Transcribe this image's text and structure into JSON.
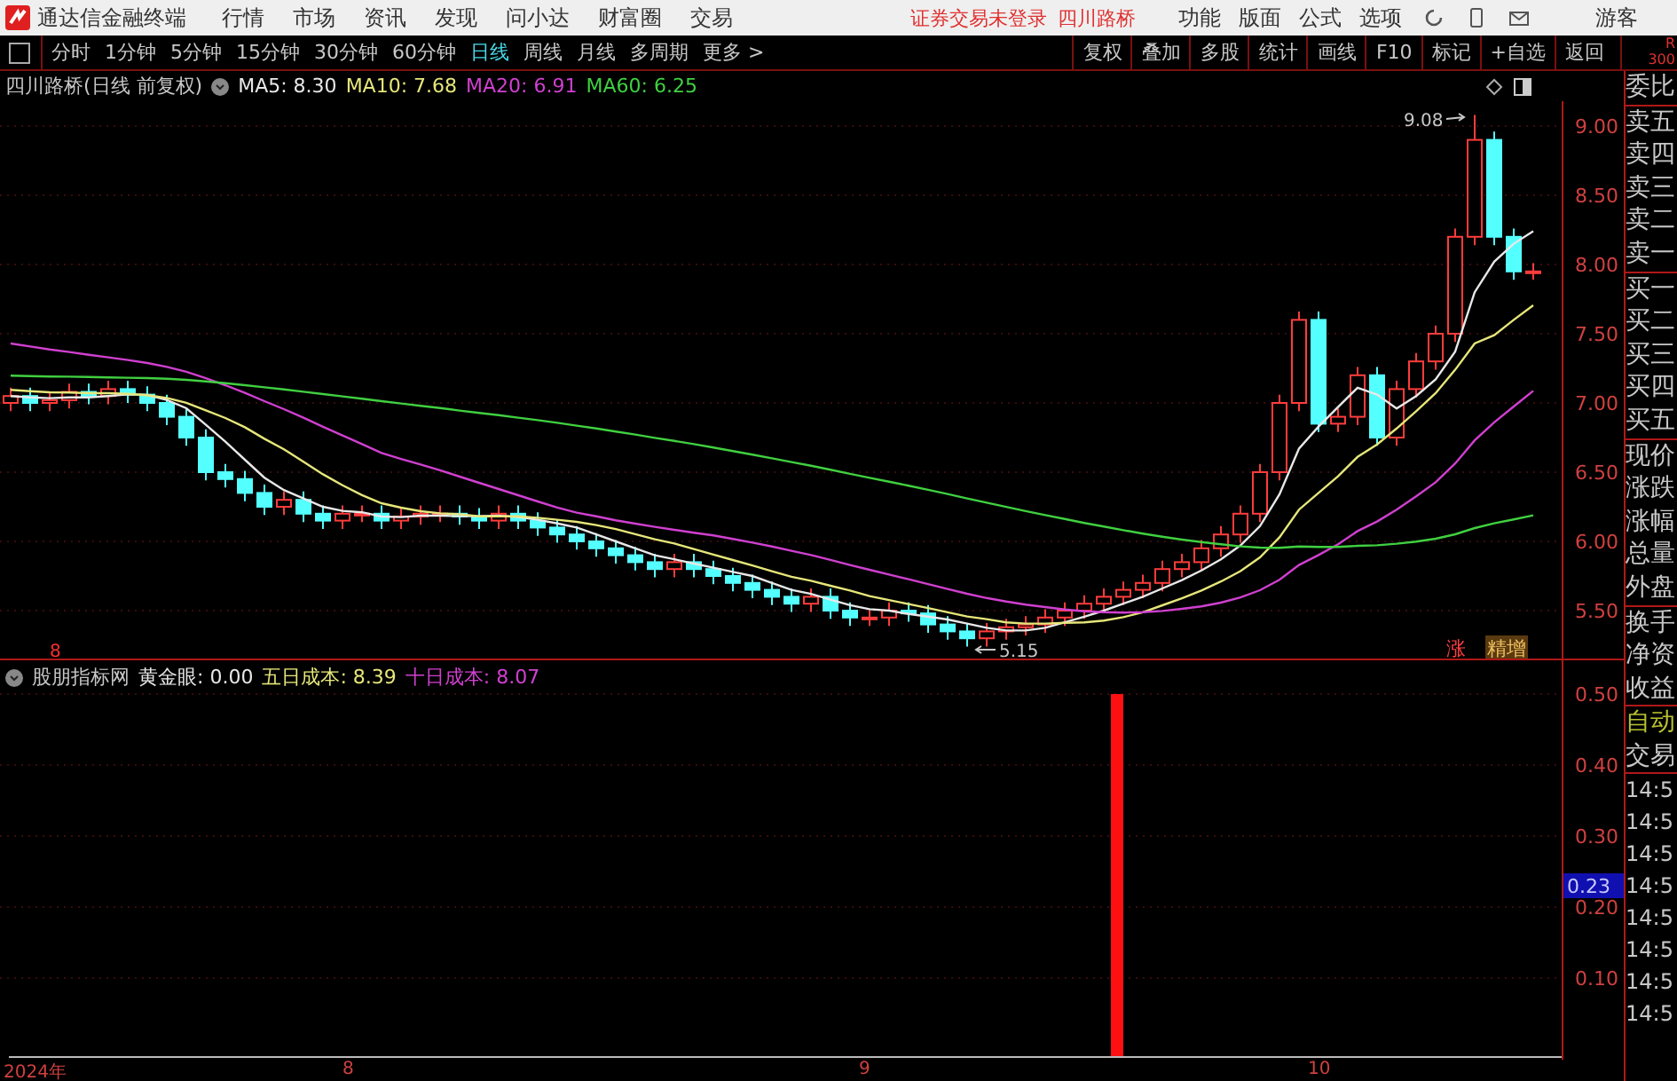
{
  "title_bar": {
    "app_name": "通达信金融终端",
    "menus": [
      "行情",
      "市场",
      "资讯",
      "发现",
      "问小达",
      "财富圈",
      "交易"
    ],
    "status": "证券交易未登录",
    "stock": "四川路桥",
    "right_menus": [
      "功能",
      "版面",
      "公式",
      "选项"
    ],
    "user": "游客"
  },
  "period_tabs": [
    {
      "label": "分时",
      "selected": false
    },
    {
      "label": "1分钟",
      "selected": false
    },
    {
      "label": "5分钟",
      "selected": false
    },
    {
      "label": "15分钟",
      "selected": false
    },
    {
      "label": "30分钟",
      "selected": false
    },
    {
      "label": "60分钟",
      "selected": false
    },
    {
      "label": "日线",
      "selected": true
    },
    {
      "label": "周线",
      "selected": false
    },
    {
      "label": "月线",
      "selected": false
    },
    {
      "label": "多周期",
      "selected": false
    },
    {
      "label": "更多 >",
      "selected": false
    }
  ],
  "tool_buttons": [
    "复权",
    "叠加",
    "多股",
    "统计",
    "画线",
    "F10",
    "标记",
    "+自选",
    "返回"
  ],
  "corner_label": [
    "R",
    "300"
  ],
  "main_chart": {
    "title": "四川路桥(日线 前复权)",
    "indicators": [
      {
        "label": "MA5: 8.30",
        "color": "#e8e8e8"
      },
      {
        "label": "MA10: 7.68",
        "color": "#e6e67a"
      },
      {
        "label": "MA20: 6.91",
        "color": "#d040d0"
      },
      {
        "label": "MA60: 6.25",
        "color": "#40d040"
      }
    ],
    "price_ticks": [
      "9.00",
      "8.50",
      "8.00",
      "7.50",
      "7.00",
      "6.50",
      "6.00",
      "5.50"
    ],
    "high_label": "9.08",
    "low_label": "5.15",
    "marker": "8",
    "tags": [
      {
        "label": "涨",
        "kind": "plain"
      },
      {
        "label": "精增",
        "kind": "boxed"
      }
    ]
  },
  "indicator_panel": {
    "name": "股朋指标网",
    "values": [
      {
        "label": "黄金眼: 0.00",
        "color": "#e8e8e8"
      },
      {
        "label": "五日成本: 8.39",
        "color": "#e6e67a"
      },
      {
        "label": "十日成本: 8.07",
        "color": "#d040d0"
      }
    ],
    "ticks": [
      "0.50",
      "0.40",
      "0.30",
      "0.20",
      "0.10"
    ],
    "cursor_value": "0.23"
  },
  "date_axis": [
    "2024年",
    "8",
    "9",
    "10"
  ],
  "side_panel": {
    "groups": [
      [
        "委比"
      ],
      [
        "卖五",
        "卖四",
        "卖三",
        "卖二",
        "卖一"
      ],
      [
        "买一",
        "买二",
        "买三",
        "买四",
        "买五"
      ],
      [
        "现价",
        "涨跌",
        "涨幅",
        "总量",
        "外盘"
      ],
      [
        "换手",
        "净资",
        "收益"
      ]
    ],
    "trade_labels": [
      "自动",
      "交易"
    ],
    "times": [
      "14:5",
      "14:5",
      "14:5",
      "14:5",
      "14:5",
      "14:5",
      "14:5",
      "14:5"
    ]
  }
}
